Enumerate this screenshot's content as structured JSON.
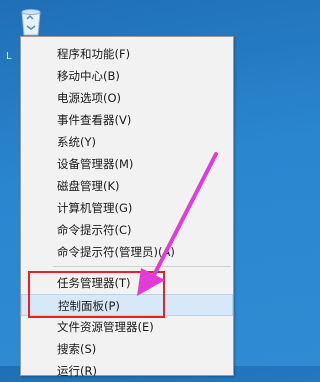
{
  "colors": {
    "desktop_bg": "#2a86cf",
    "menu_bg": "#f2f2f2",
    "highlight_bg": "#d7e8f9",
    "annotation_red": "#e8202a",
    "annotation_arrow": "#e23bd6"
  },
  "desktop": {
    "side_label": "L",
    "icon": "recycle-bin-icon"
  },
  "menu": {
    "items": [
      "程序和功能(F)",
      "移动中心(B)",
      "电源选项(O)",
      "事件查看器(V)",
      "系统(Y)",
      "设备管理器(M)",
      "磁盘管理(K)",
      "计算机管理(G)",
      "命令提示符(C)",
      "命令提示符(管理员)(A)",
      "任务管理器(T)",
      "控制面板(P)",
      "文件资源管理器(E)",
      "搜索(S)",
      "运行(R)"
    ],
    "highlighted_item": "控制面板(P)"
  }
}
